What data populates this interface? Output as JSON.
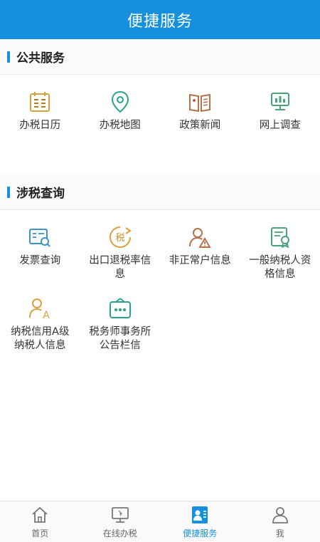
{
  "header": {
    "title": "便捷服务"
  },
  "public_services": {
    "title": "公共服务",
    "items": [
      {
        "label": "办税日历",
        "icon": "calendar-icon"
      },
      {
        "label": "办税地图",
        "icon": "map-pin-icon"
      },
      {
        "label": "政策新闻",
        "icon": "news-book-icon"
      },
      {
        "label": "网上调查",
        "icon": "survey-screen-icon"
      }
    ]
  },
  "tax_query": {
    "title": "涉税查询",
    "items": [
      {
        "label": "发票查询",
        "icon": "invoice-search-icon"
      },
      {
        "label": "出口退税率信息",
        "icon": "tax-refund-icon"
      },
      {
        "label": "非正常户信息",
        "icon": "abnormal-user-icon"
      },
      {
        "label": "一般纳税人资格信息",
        "icon": "certificate-icon"
      },
      {
        "label": "纳税信用A级纳税人信息",
        "icon": "credit-a-icon"
      },
      {
        "label": "税务师事务所公告栏信",
        "icon": "bulletin-board-icon"
      }
    ]
  },
  "tabbar": {
    "tabs": [
      {
        "label": "首页",
        "icon": "home-icon",
        "active": false
      },
      {
        "label": "在线办税",
        "icon": "monitor-icon",
        "active": false
      },
      {
        "label": "便捷服务",
        "icon": "service-card-icon",
        "active": true
      },
      {
        "label": "我",
        "icon": "user-icon",
        "active": false
      }
    ]
  },
  "colors": {
    "brand_blue": "#1490df",
    "icon_gold": "#d9a13c",
    "icon_teal": "#2aa38e",
    "icon_brown": "#b5714a",
    "icon_green": "#4aa37a",
    "icon_blue": "#3b93c9"
  }
}
